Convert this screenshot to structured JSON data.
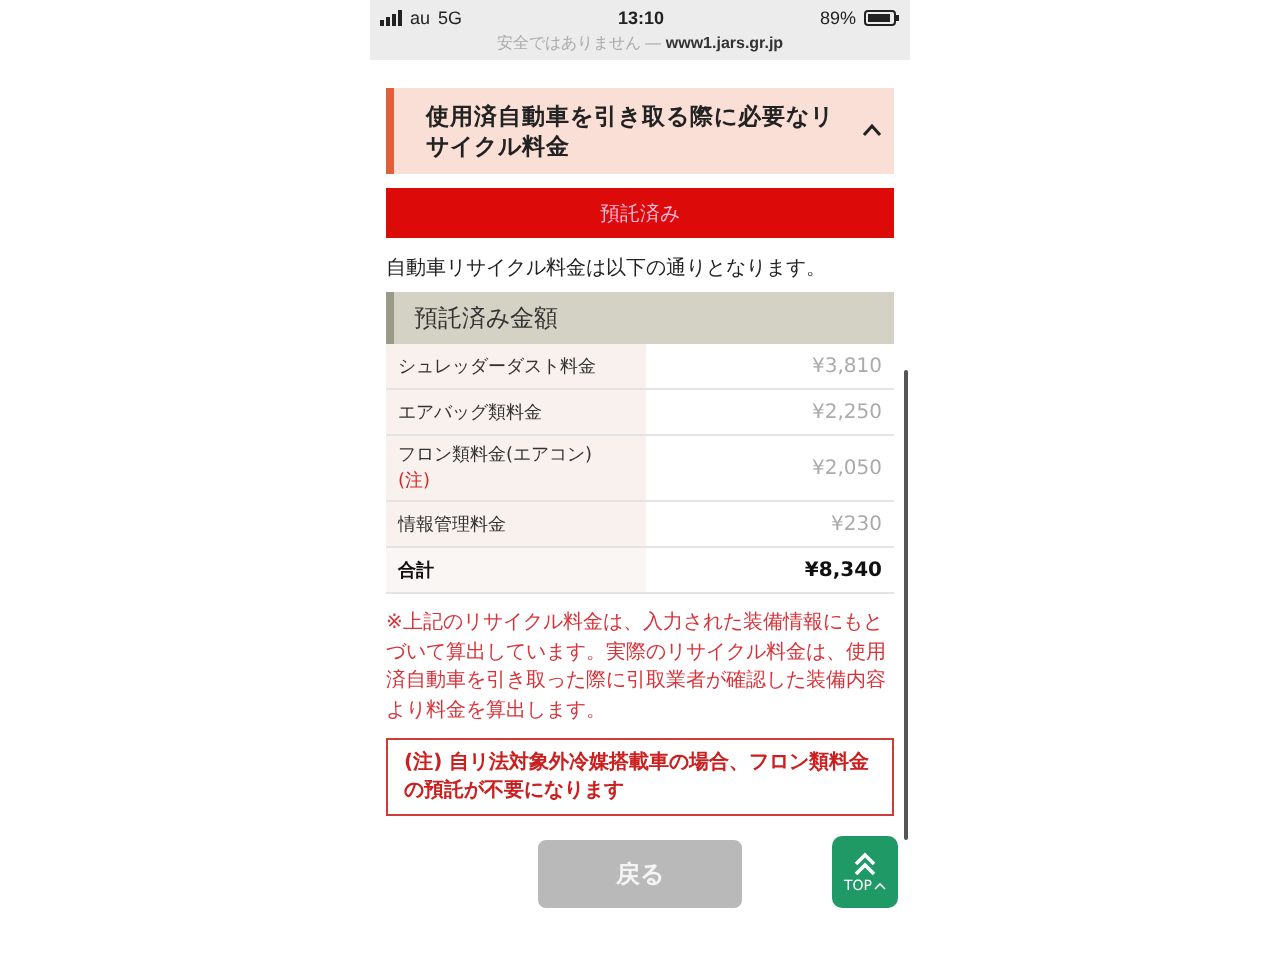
{
  "status_bar": {
    "carrier": "au",
    "network": "5G",
    "time": "13:10",
    "battery": "89%",
    "address": "安全ではありません — **www1.jars.gr.jp**"
  },
  "section": {
    "title": "使用済自動車を引き取る際に必要なリサイクル料金",
    "expanded": true
  },
  "status_banner": "預託済み",
  "intro": "自動車リサイクル料金は以下の通りとなります。",
  "fee_table": {
    "heading": "預託済み金額",
    "rows": [
      {
        "kind": "item",
        "label": "シュレッダーダスト料金",
        "amount": "¥3,810"
      },
      {
        "kind": "item",
        "label": "エアバッグ類料金",
        "amount": "¥2,250"
      },
      {
        "kind": "item",
        "label": "フロン類料金(エアコン)",
        "note": "(注)",
        "amount": "¥2,050"
      },
      {
        "kind": "item",
        "label": "情報管理料金",
        "amount": "¥230"
      },
      {
        "kind": "total",
        "label": "合計",
        "amount": "¥8,340"
      }
    ]
  },
  "notice": "※上記のリサイクル料金は、入力された装備情報にもとづいて算出しています。実際のリサイクル料金は、使用済自動車を引き取った際に引取業者が確認した装備内容より料金を算出します。",
  "warning": "(注) 自リ法対象外冷媒搭載車の場合、フロン類料金の預託が不要になります",
  "back_button": "戻る",
  "top_button": "TOP"
}
